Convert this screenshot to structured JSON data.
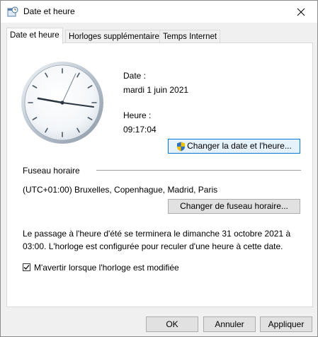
{
  "window": {
    "title": "Date et heure"
  },
  "tabs": [
    {
      "label": "Date et heure"
    },
    {
      "label": "Horloges supplémentaires"
    },
    {
      "label": "Temps Internet"
    }
  ],
  "main": {
    "date_label": "Date :",
    "date_value": "mardi 1 juin 2021",
    "time_label": "Heure :",
    "time_value": "09:17:04",
    "change_datetime_button": "Changer la date et l'heure...",
    "timezone_heading": "Fuseau horaire",
    "timezone_value": "(UTC+01:00) Bruxelles, Copenhague, Madrid, Paris",
    "change_timezone_button": "Changer de fuseau horaire...",
    "dst_line1": "Le passage à l'heure d'été se terminera le dimanche 31 octobre 2021 à",
    "dst_line2": "03:00. L'horloge est configurée pour reculer d'une heure à cette date.",
    "notify_checkbox_label": "M'avertir lorsque l'horloge est modifiée",
    "notify_checked": true
  },
  "footer": {
    "ok": "OK",
    "cancel": "Annuler",
    "apply": "Appliquer"
  }
}
